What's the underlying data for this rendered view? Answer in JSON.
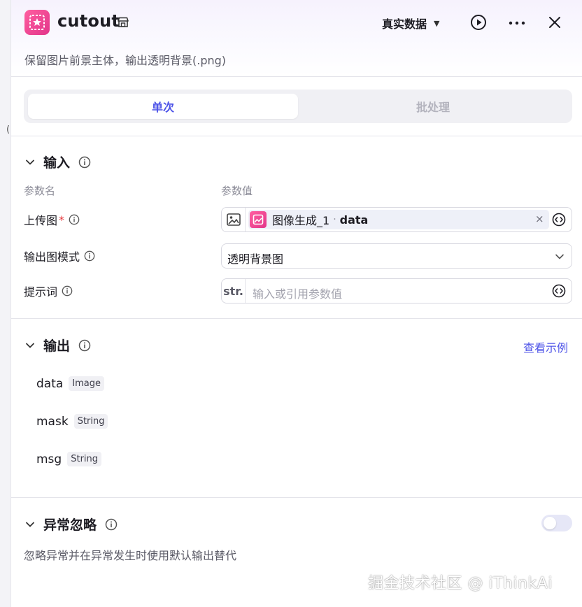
{
  "left_strip": {
    "mark": "("
  },
  "header": {
    "app_icon": "cutout-app-icon",
    "title": "cutout",
    "store_icon": "store-icon",
    "data_mode": "真实数据",
    "subtitle": "保留图片前景主体，输出透明背景(.png)",
    "colors": {
      "accent": "#4d53e8",
      "brand": "#e2358a"
    }
  },
  "tabs": [
    {
      "label": "单次",
      "active": true
    },
    {
      "label": "批处理",
      "active": false
    }
  ],
  "input_section": {
    "title": "输入",
    "col_name": "参数名",
    "col_value": "参数值",
    "params": [
      {
        "label": "上传图",
        "required_mark": "*",
        "prefix_icon": "image-icon",
        "ref_node": "图像生成_1",
        "ref_sep": "·",
        "ref_var": "data",
        "clear": "×"
      },
      {
        "label": "输出图模式",
        "value": "透明背景图"
      },
      {
        "label": "提示词",
        "prefix": "str.",
        "placeholder": "输入或引用参数值"
      }
    ]
  },
  "output_section": {
    "title": "输出",
    "view_example": "查看示例",
    "outputs": [
      {
        "name": "data",
        "type": "Image"
      },
      {
        "name": "mask",
        "type": "String"
      },
      {
        "name": "msg",
        "type": "String"
      }
    ]
  },
  "exception_section": {
    "title": "异常忽略",
    "enabled": false,
    "description": "忽略异常并在异常发生时使用默认输出替代"
  },
  "watermark": "掘金技术社区 @ iThinkAi"
}
